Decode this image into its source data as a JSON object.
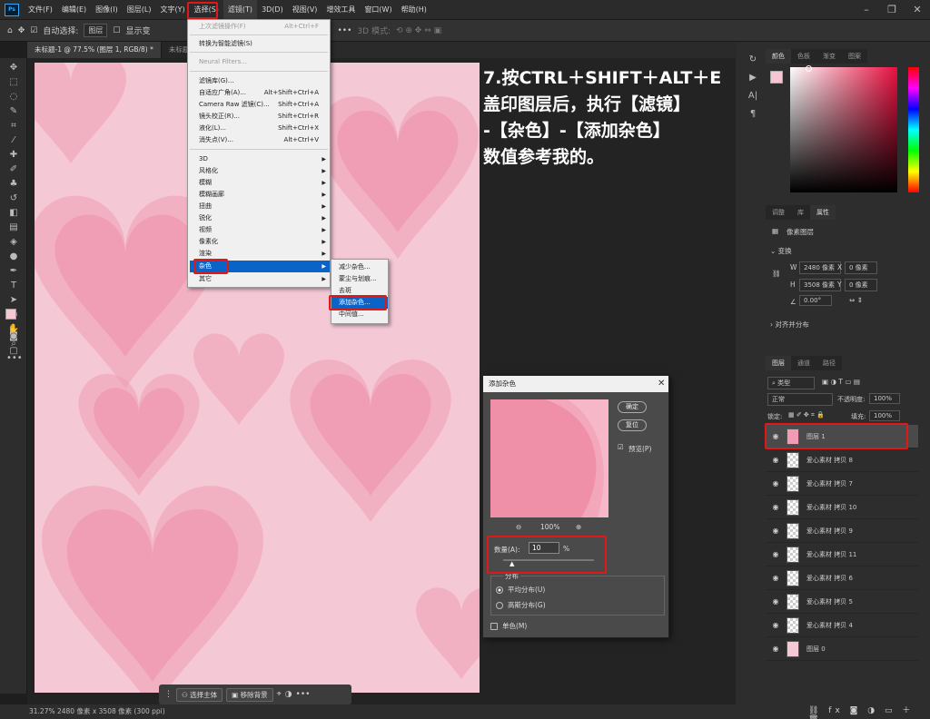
{
  "app": {
    "logo": "Ps"
  },
  "menubar": [
    {
      "label": "文件(F)"
    },
    {
      "label": "编辑(E)"
    },
    {
      "label": "图像(I)"
    },
    {
      "label": "图层(L)"
    },
    {
      "label": "文字(Y)"
    },
    {
      "label": "选择(S)"
    },
    {
      "label": "滤镜(T)"
    },
    {
      "label": "3D(D)"
    },
    {
      "label": "视图(V)"
    },
    {
      "label": "增效工具"
    },
    {
      "label": "窗口(W)"
    },
    {
      "label": "帮助(H)"
    }
  ],
  "optionsbar": {
    "auto_select": "自动选择:",
    "target": "图层",
    "show_transform": "显示变",
    "mode_3d": "3D 模式:"
  },
  "doc_tabs": [
    "未标题-1 @ 77.5% (图层 1, RGB/8) *",
    "未标题-2"
  ],
  "filter_menu": {
    "items": [
      {
        "label": "上次滤镜操作(F)",
        "shortcut": "Alt+Ctrl+F",
        "disabled": true
      },
      {
        "label": "转换为智能滤镜(S)"
      },
      {
        "label": "Neural Filters...",
        "disabled": true
      },
      {
        "label": "滤镜库(G)..."
      },
      {
        "label": "自适应广角(A)...",
        "shortcut": "Alt+Shift+Ctrl+A"
      },
      {
        "label": "Camera Raw 滤镜(C)...",
        "shortcut": "Shift+Ctrl+A"
      },
      {
        "label": "镜头校正(R)...",
        "shortcut": "Shift+Ctrl+R"
      },
      {
        "label": "液化(L)...",
        "shortcut": "Shift+Ctrl+X"
      },
      {
        "label": "消失点(V)...",
        "shortcut": "Alt+Ctrl+V"
      },
      {
        "label": "3D"
      },
      {
        "label": "风格化"
      },
      {
        "label": "模糊"
      },
      {
        "label": "模糊画廊"
      },
      {
        "label": "扭曲"
      },
      {
        "label": "锐化"
      },
      {
        "label": "视频"
      },
      {
        "label": "像素化"
      },
      {
        "label": "渲染"
      },
      {
        "label": "杂色"
      },
      {
        "label": "其它"
      }
    ]
  },
  "noise_submenu": [
    "减少杂色...",
    "蒙尘与划痕...",
    "去斑",
    "添加杂色...",
    "中间值..."
  ],
  "instruction": {
    "line1": "7.按CTRL＋SHIFT＋ALT＋E",
    "line2": "盖印图层后，执行【滤镜】",
    "line3": "-【杂色】-【添加杂色】",
    "line4": "数值参考我的。"
  },
  "dialog": {
    "title": "添加杂色",
    "ok": "确定",
    "reset": "复位",
    "preview_label": "预览(P)",
    "zoom": "100%",
    "amount_label": "数量(A):",
    "amount_value": "10",
    "amount_unit": "%",
    "amount_slider_fraction": 0.1,
    "distribution_label": "分布",
    "uniform": "平均分布(U)",
    "gaussian": "高斯分布(G)",
    "mono": "单色(M)"
  },
  "color_panel": {
    "tabs": [
      "颜色",
      "色板",
      "渐变",
      "图案"
    ],
    "foreground": "#f7c6d3",
    "background": "#ff6f8f"
  },
  "props_panel": {
    "tabs": [
      "调整",
      "库",
      "属性"
    ],
    "type": "像素图层",
    "transform": "变换",
    "w_label": "W",
    "w_value": "2480 像素",
    "x_label": "X",
    "x_value": "0 像素",
    "h_label": "H",
    "h_value": "3508 像素",
    "y_label": "Y",
    "y_value": "0 像素",
    "angle": "0.00°",
    "align": "对齐并分布"
  },
  "layers_panel": {
    "tabs": [
      "图层",
      "通道",
      "路径"
    ],
    "filter_kind": "类型",
    "blend_mode": "正常",
    "opacity_label": "不透明度:",
    "opacity_value": "100%",
    "lock_label": "锁定:",
    "fill_label": "填充:",
    "fill_value": "100%",
    "layers": [
      {
        "name": "图层 1"
      },
      {
        "name": "爱心素材 拷贝 8"
      },
      {
        "name": "爱心素材 拷贝 7"
      },
      {
        "name": "爱心素材 拷贝 10"
      },
      {
        "name": "爱心素材 拷贝 9"
      },
      {
        "name": "爱心素材 拷贝 11"
      },
      {
        "name": "爱心素材 拷贝 6"
      },
      {
        "name": "爱心素材 拷贝 5"
      },
      {
        "name": "爱心素材 拷贝 4"
      },
      {
        "name": "图层 0"
      }
    ]
  },
  "context_bar": {
    "select_subject": "选择主体",
    "remove_bg": "移除背景"
  },
  "status": {
    "text": "31.27%  2480 像素 x 3508 像素 (300 ppi)"
  },
  "colors": {
    "accent": "#0a64c8",
    "highlight_box": "#e01818",
    "canvas_pink": "#f5c8d6",
    "heart_pink": "#ef9db5"
  }
}
